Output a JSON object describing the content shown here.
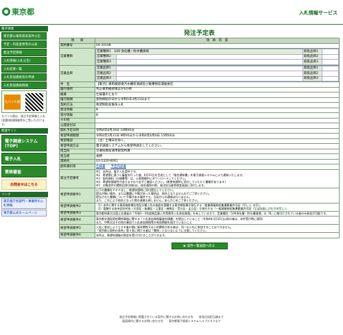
{
  "header": {
    "logo_text": "東京都",
    "service_name": "入札情報サービス"
  },
  "sidebar": {
    "title": "電子調達",
    "items": [
      "東京都公報等発表案件公告",
      "予定・内容変更等の公表",
      "発注予定情報",
      "入札情報(入札公告)",
      "入札結果一覧",
      "入札参加資格等の申請",
      "入札参加資格情報"
    ],
    "mobile_label": "モバイル版",
    "note": "モバイル版は、発注予定情報と入札(見積)経過情報等をご覧いただけます。",
    "section2_title": "関連サイト",
    "big_items": [
      "電子調達システム(TOP)",
      "電子入札",
      "資格審査"
    ],
    "chat_label": "お問合せはこちら",
    "links_title": "リンク",
    "links": [
      "東京都庁各部門・事業所の入札情報",
      "東京都公式ホームページ"
    ]
  },
  "main": {
    "title": "発注予定表",
    "head_item": "項　　目",
    "head_content": "項　目　内　容",
    "rows": [
      {
        "label": "契約番号",
        "value": "04-20108"
      },
      {
        "label": "営業種目",
        "value": "営業種目1　109 浄化槽・貯水槽清掃"
      },
      {
        "label": "営業品目",
        "value": ""
      },
      {
        "label": "件　名",
        "value": "【電子】車両検修場汚水槽等清掃及び廃棄物収運搬委託"
      },
      {
        "label": "履行場所",
        "value": "馬込車両検修場ほか6か所"
      },
      {
        "label": "概要",
        "value": "仕様書のとおり"
      },
      {
        "label": "履行期間",
        "value": "契約締結の日から令和5年3月31日まで"
      },
      {
        "label": "契約方法",
        "value": "希望制指名競争入札"
      },
      {
        "label": "発注等級",
        "value": "B"
      },
      {
        "label": "受付等級",
        "value": "B"
      },
      {
        "label": "その他",
        "value": ""
      },
      {
        "label": "公開受付日",
        "value": ""
      },
      {
        "label": "開札予定日時",
        "value": "令和4年6月30日 10時00分"
      },
      {
        "label": "希望申請期間",
        "value": "令和4年5月31日 9時00分から令和4年6月6日 15時00分"
      },
      {
        "label": "希望確認",
        "value": "（注）土曜日を除く。"
      },
      {
        "label": "希望申請方法",
        "value": "電子調達システムから希望申請をしてください。"
      },
      {
        "label": "担当局",
        "value": "交通局資産運用部契約課"
      },
      {
        "label": "担当者",
        "value": "長野"
      },
      {
        "label": "連絡先",
        "value": "03-5320-6061"
      },
      {
        "label": "配布資料等",
        "value": ""
      },
      {
        "label": "発注予定備考",
        "value": "※1　本件は、電子入札案件です。\n※2　希望票に基づく審査を行った後、6月15日を目途として「指名通知書」を電子調達システムにより通知いたします。\n※3　配布資料（仕様書等）は、公表期間中にダウンロードしてください。\n※4　希望申請要件がありますので必ずご確認ください。(希望申請時に添付していただく書類があります)\n※5　対象案件の関係回答(別紙)は、指名通知の際、発注担当者等便宜画面に添付します。"
      },
      {
        "label": "希望申請要件1",
        "value": "以下の書類をＰＤＦ化し、希望申請時に添付提出してください。\n提出が無い場合、または書類に不備があった場合は、指名となりませんのでご了承ください。\n提出された書類について不備がある場合でも、当局からの連絡は行いません。\nまた、これにより指名となった際の連絡も致しません。あらかじめご了承ください。"
      },
      {
        "label": "希望申請要件2",
        "value": "（1）本件に関する車両検修場在地及び搬入先の施設を管轄する東京都知事が発行する「産業廃棄物収集運搬業許可証（写し）」の写し\n（2）管轄する各市区町村長（大田区・板橋区・江東区・練馬区・荒川区・足立区）が発行する「一般廃棄物収集運搬業許可証（又は計画しけだけの写し）」"
      },
      {
        "label": "希望申請要件3",
        "value": "東京都知事又は国土交通省の「令和3・4年度物品買入共等競争入札参加資格」を有している方で、営業種目「109浄化槽・貯水槽清掃」の「B」に格付けされている者のみ参加が可能です。"
      },
      {
        "label": "希望申請要件4",
        "value": "東京都交通局契約関係事務に関する「入札参加資格審査申請書」を提出していること（令和4年3月31日以前の者は、本件受付時に適用）\nまた、中断又はその他の事由で入札参加資格等の有効期間を過ぎていないこと"
      },
      {
        "label": "希望申請要件5",
        "value": "入札に参加しようとする者の間に資本関係又は人的関係がある者は、同一の入札に参加することはできません。\n「東京都公契約の条例」第２条に掲げる者は「関係」とならないように注意してください。"
      },
      {
        "label": "希望申請要件6",
        "value": "本件は、希望申請後の照会を受け付けることができます。"
      }
    ],
    "hinmoku_labels": [
      "取扱品目1",
      "取扱品目2",
      "取扱品目3"
    ],
    "shumoku_labels": [
      "営業種目2",
      "営業種目3"
    ],
    "hinmoku1": "営業品目1",
    "hinmoku2": "営業品目2",
    "hinmoku3": "営業品目3",
    "doc1": "仕様書",
    "doc2": "予定内訳書",
    "back_button": "案件一覧画面へ戻る"
  },
  "footer": {
    "line1": "発注予定情報に掲載されている案件に関するお問い合わせ先　　各発注局担当課まで",
    "line2": "画面操作に関するお問い合わせ先　　東京都電子調達システムヘルプデスクまで"
  }
}
